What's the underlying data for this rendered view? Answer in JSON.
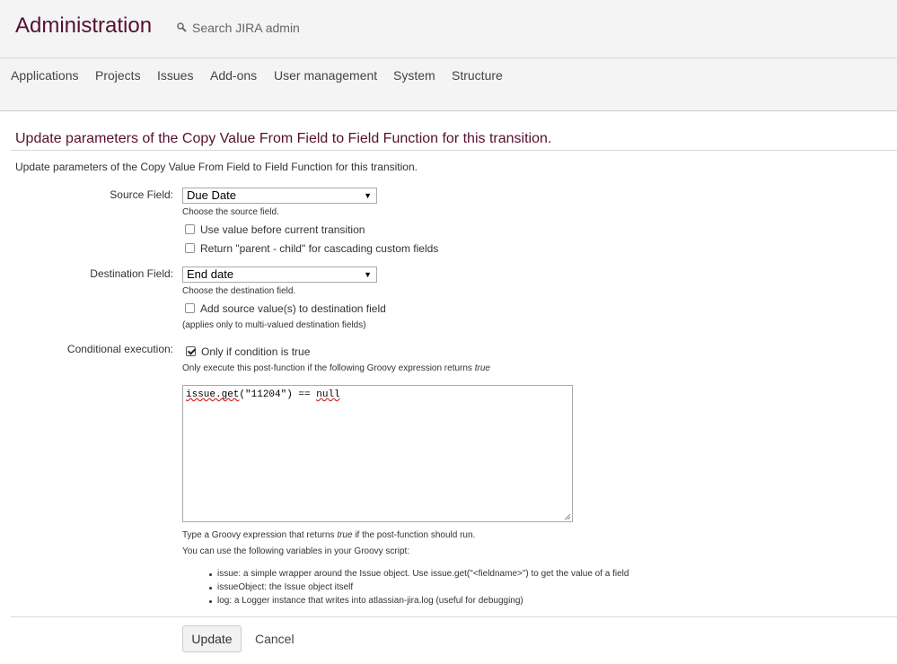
{
  "header": {
    "title": "Administration",
    "search_placeholder": "Search JIRA admin"
  },
  "nav": {
    "items": [
      {
        "label": "Applications"
      },
      {
        "label": "Projects"
      },
      {
        "label": "Issues"
      },
      {
        "label": "Add-ons"
      },
      {
        "label": "User management"
      },
      {
        "label": "System"
      },
      {
        "label": "Structure"
      }
    ]
  },
  "page": {
    "title": "Update parameters of the Copy Value From Field to Field Function for this transition.",
    "description": "Update parameters of the Copy Value From Field to Field Function for this transition."
  },
  "form": {
    "source": {
      "label": "Source Field:",
      "value": "Due Date",
      "hint": "Choose the source field.",
      "use_before_label": "Use value before current transition",
      "use_before_checked": false,
      "cascading_label": "Return \"parent - child\" for cascading custom fields",
      "cascading_checked": false
    },
    "destination": {
      "label": "Destination Field:",
      "value": "End date",
      "hint": "Choose the destination field.",
      "add_label": "Add source value(s) to destination field",
      "add_checked": false,
      "add_hint": "(applies only to multi-valued destination fields)"
    },
    "conditional": {
      "label": "Conditional execution:",
      "checkbox_label": "Only if condition is true",
      "checked": true,
      "hint_prefix": "Only execute this post-function if the following Groovy expression returns ",
      "hint_em": "true",
      "code": {
        "part1": "issue.get",
        "part2": "(\"11204\") == ",
        "part3": "null"
      },
      "help_prefix": "Type a Groovy expression that returns ",
      "help_em": "true",
      "help_suffix": " if the post-function should run.",
      "vars_intro": "You can use the following variables in your Groovy script:",
      "vars": [
        "issue: a simple wrapper around the Issue object. Use issue.get(\"<fieldname>\") to get the value of a field",
        "issueObject: the Issue object itself",
        "log: a Logger instance that writes into atlassian-jira.log (useful for debugging)"
      ]
    }
  },
  "actions": {
    "update_label": "Update",
    "cancel_label": "Cancel"
  }
}
